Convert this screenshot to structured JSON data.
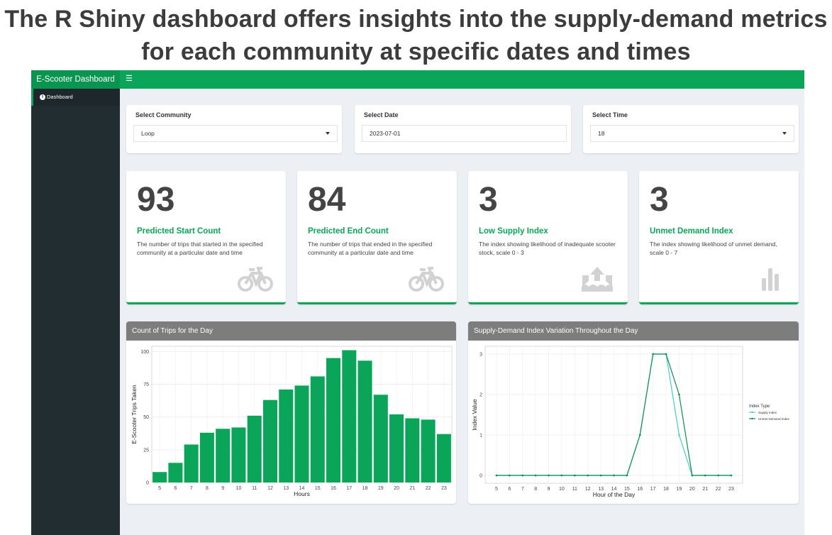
{
  "headline": {
    "line1": "The R Shiny dashboard offers insights into the supply-demand metrics",
    "line2": "for each community at specific dates and times"
  },
  "app": {
    "brand": "E-Scooter Dashboard",
    "menu_icon": "hamburger-icon",
    "accent_color": "#0ba55a",
    "sidebar": {
      "items": [
        {
          "label": "Dashboard",
          "icon": "info-circle-icon"
        }
      ]
    }
  },
  "filters": {
    "community": {
      "label": "Select Community",
      "value": "Loop"
    },
    "date": {
      "label": "Select Date",
      "value": "2023-07-01"
    },
    "time": {
      "label": "Select Time",
      "value": "18"
    }
  },
  "value_boxes": [
    {
      "value": "93",
      "title": "Predicted Start Count",
      "desc": "The number of trips that started in the specified community at a particular date and time",
      "icon": "bicycle-icon"
    },
    {
      "value": "84",
      "title": "Predicted End Count",
      "desc": "The number of trips that ended in the specified community at a particular date and time",
      "icon": "bicycle-icon"
    },
    {
      "value": "3",
      "title": "Low Supply Index",
      "desc": "The index showing likelihood of inadequate scooter stock, scale 0 - 3",
      "icon": "upload-water-icon"
    },
    {
      "value": "3",
      "title": "Unmet Demand Index",
      "desc": "The index showing likelihood of unmet demand, scale 0 - 7",
      "icon": "bar-chart-icon"
    }
  ],
  "panels": {
    "trips": {
      "title": "Count of Trips for the Day"
    },
    "index": {
      "title": "Supply-Demand Index Variation Throughout the Day"
    }
  },
  "chart_data": [
    {
      "type": "bar",
      "title": "",
      "xlabel": "Hours",
      "ylabel": "E-Scooter Trips Taken",
      "categories": [
        5,
        6,
        7,
        8,
        9,
        10,
        11,
        12,
        13,
        14,
        15,
        16,
        17,
        18,
        19,
        20,
        21,
        22,
        23
      ],
      "values": [
        8,
        15,
        29,
        38,
        41,
        42,
        51,
        63,
        71,
        74,
        81,
        95,
        101,
        93,
        67,
        52,
        49,
        48,
        37
      ],
      "yticks": [
        0,
        25,
        50,
        75,
        100
      ],
      "ylim": [
        0,
        104
      ],
      "bar_color": "#0ba55a",
      "grid": true
    },
    {
      "type": "line",
      "title": "",
      "xlabel": "Hour of the Day",
      "ylabel": "Index Value",
      "x": [
        5,
        6,
        7,
        8,
        9,
        10,
        11,
        12,
        13,
        14,
        15,
        16,
        17,
        18,
        19,
        20,
        21,
        22,
        23
      ],
      "yticks": [
        0,
        1,
        2,
        3
      ],
      "ylim": [
        0,
        3
      ],
      "legend_title": "Index Type",
      "legend_position": "right",
      "grid": true,
      "series": [
        {
          "name": "Supply Index",
          "color": "#3fd0c9",
          "values": [
            0,
            0,
            0,
            0,
            0,
            0,
            0,
            0,
            0,
            0,
            0,
            1,
            3,
            3,
            1,
            0,
            0,
            0,
            0
          ]
        },
        {
          "name": "Unmet Demand Index",
          "color": "#0a8f4e",
          "values": [
            0,
            0,
            0,
            0,
            0,
            0,
            0,
            0,
            0,
            0,
            0,
            1,
            3,
            3,
            2,
            0,
            0,
            0,
            0
          ]
        }
      ]
    }
  ]
}
